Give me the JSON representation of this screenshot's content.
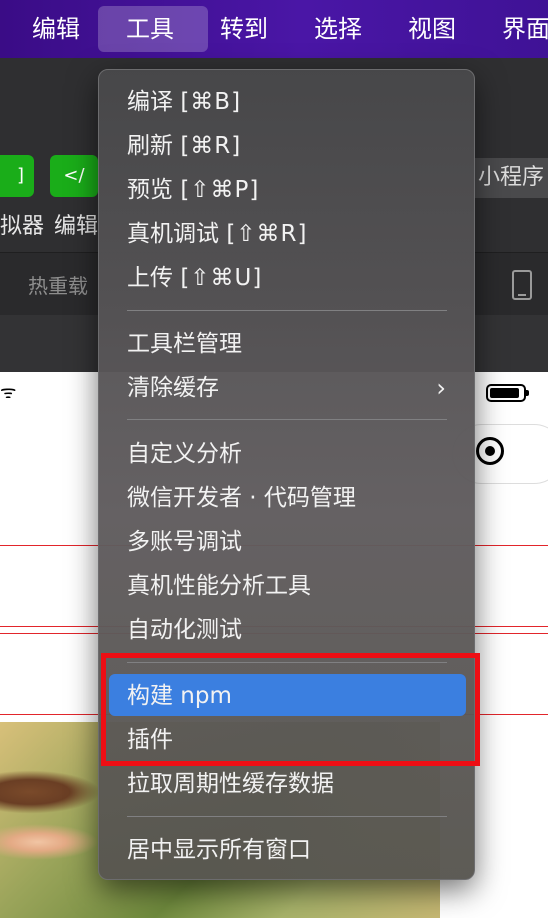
{
  "menubar": {
    "items": [
      "编辑",
      "工具",
      "转到",
      "选择",
      "视图",
      "界面"
    ],
    "active": "工具"
  },
  "background": {
    "button_left": "]",
    "button_code": "</",
    "label_simulator": "拟器",
    "label_editor": "编辑",
    "mini_program": "小程序",
    "hot_reload": "热重载",
    "wifi": "ᯤ"
  },
  "tools_menu": {
    "group1": [
      {
        "label": "编译",
        "shortcut": "[⌘B]"
      },
      {
        "label": "刷新",
        "shortcut": "[⌘R]"
      },
      {
        "label": "预览",
        "shortcut": "[⇧⌘P]"
      },
      {
        "label": "真机调试",
        "shortcut": "[⇧⌘R]"
      },
      {
        "label": "上传",
        "shortcut": "[⇧⌘U]"
      }
    ],
    "group2": [
      {
        "label": "工具栏管理"
      },
      {
        "label": "清除缓存",
        "submenu": "›"
      }
    ],
    "group3": [
      {
        "label": "自定义分析"
      },
      {
        "label": "微信开发者 · 代码管理"
      },
      {
        "label": "多账号调试"
      },
      {
        "label": "真机性能分析工具"
      },
      {
        "label": "自动化测试"
      }
    ],
    "group4": [
      {
        "label": "构建 npm",
        "highlighted": true
      },
      {
        "label": "插件"
      },
      {
        "label": "拉取周期性缓存数据"
      }
    ],
    "group5": [
      {
        "label": "居中显示所有窗口"
      }
    ]
  },
  "colors": {
    "menubar": "#4a16a6",
    "highlight": "#3b7fe0",
    "annotation_box": "#ee0e14",
    "wechat_green": "#1aad19"
  }
}
